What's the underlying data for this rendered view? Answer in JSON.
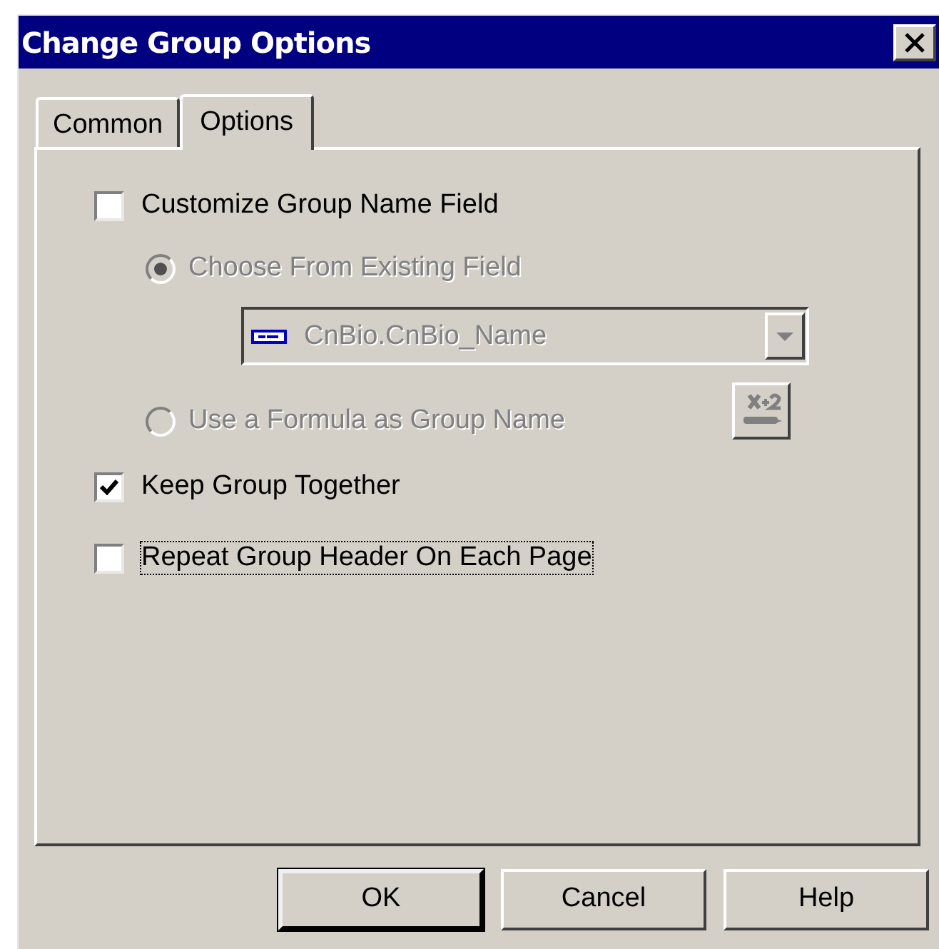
{
  "window": {
    "title": "Change Group Options"
  },
  "tabs": [
    {
      "label": "Common",
      "selected": false
    },
    {
      "label": "Options",
      "selected": true
    }
  ],
  "options": [
    {
      "kind": "checkbox",
      "label": "Customize Group Name Field",
      "checked": false,
      "disabled": false,
      "focused": false
    },
    {
      "kind": "radio",
      "label": "Choose From Existing Field",
      "selected": true,
      "disabled": true
    },
    {
      "kind": "dropdown",
      "value": "CnBio.CnBio_Name",
      "disabled": true
    },
    {
      "kind": "radio",
      "label": "Use a Formula as Group Name",
      "selected": false,
      "disabled": true
    },
    {
      "kind": "checkbox",
      "label": "Keep Group Together",
      "checked": true,
      "disabled": false,
      "focused": false
    },
    {
      "kind": "checkbox",
      "label": "Repeat Group Header On Each Page",
      "checked": false,
      "disabled": false,
      "focused": true
    }
  ],
  "buttons": [
    {
      "label": "OK",
      "default": true
    },
    {
      "label": "Cancel",
      "default": false
    },
    {
      "label": "Help",
      "default": false
    }
  ]
}
